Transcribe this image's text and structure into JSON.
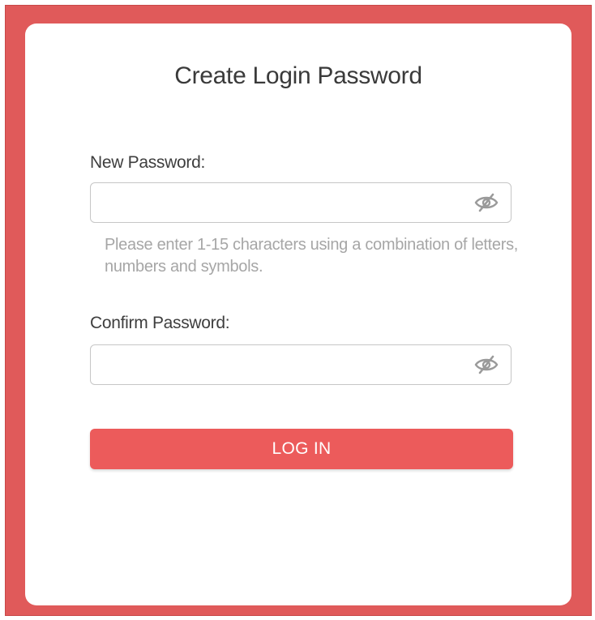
{
  "form": {
    "title": "Create Login Password",
    "new_password": {
      "label": "New Password:",
      "value": "",
      "visibility_icon": "eye-slash-icon"
    },
    "hint": "Please enter 1-15 characters using a combination of letters, numbers and symbols.",
    "confirm_password": {
      "label": "Confirm Password:",
      "value": "",
      "visibility_icon": "eye-slash-icon"
    },
    "login_button": "LOG IN"
  },
  "colors": {
    "brand": "#e05a5a",
    "button": "#ec5b5b",
    "hint_text": "#a6a6a6"
  }
}
